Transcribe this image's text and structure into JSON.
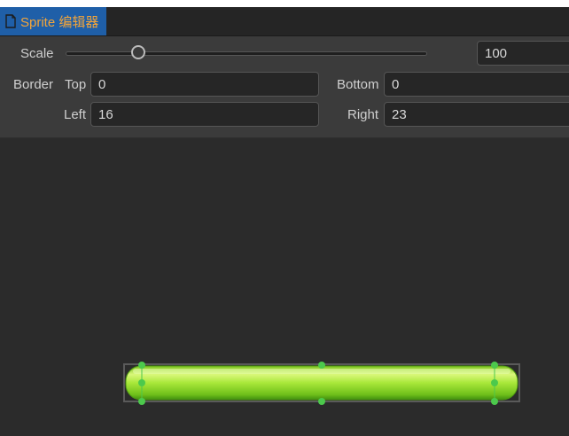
{
  "tab": {
    "title": "Sprite 编辑器",
    "icon": "document-icon"
  },
  "controls": {
    "scale_label": "Scale",
    "scale_value": "100",
    "scale_level": 0.2,
    "border_label": "Border",
    "top_label": "Top",
    "top_value": "0",
    "bottom_label": "Bottom",
    "bottom_value": "0",
    "left_label": "Left",
    "left_value": "16",
    "right_label": "Right",
    "right_value": "23"
  },
  "colors": {
    "tab_bg": "#1f5fa8",
    "tab_text": "#f3a53a",
    "sprite_green": "#9be22d",
    "handle_green": "#4cc94c"
  }
}
